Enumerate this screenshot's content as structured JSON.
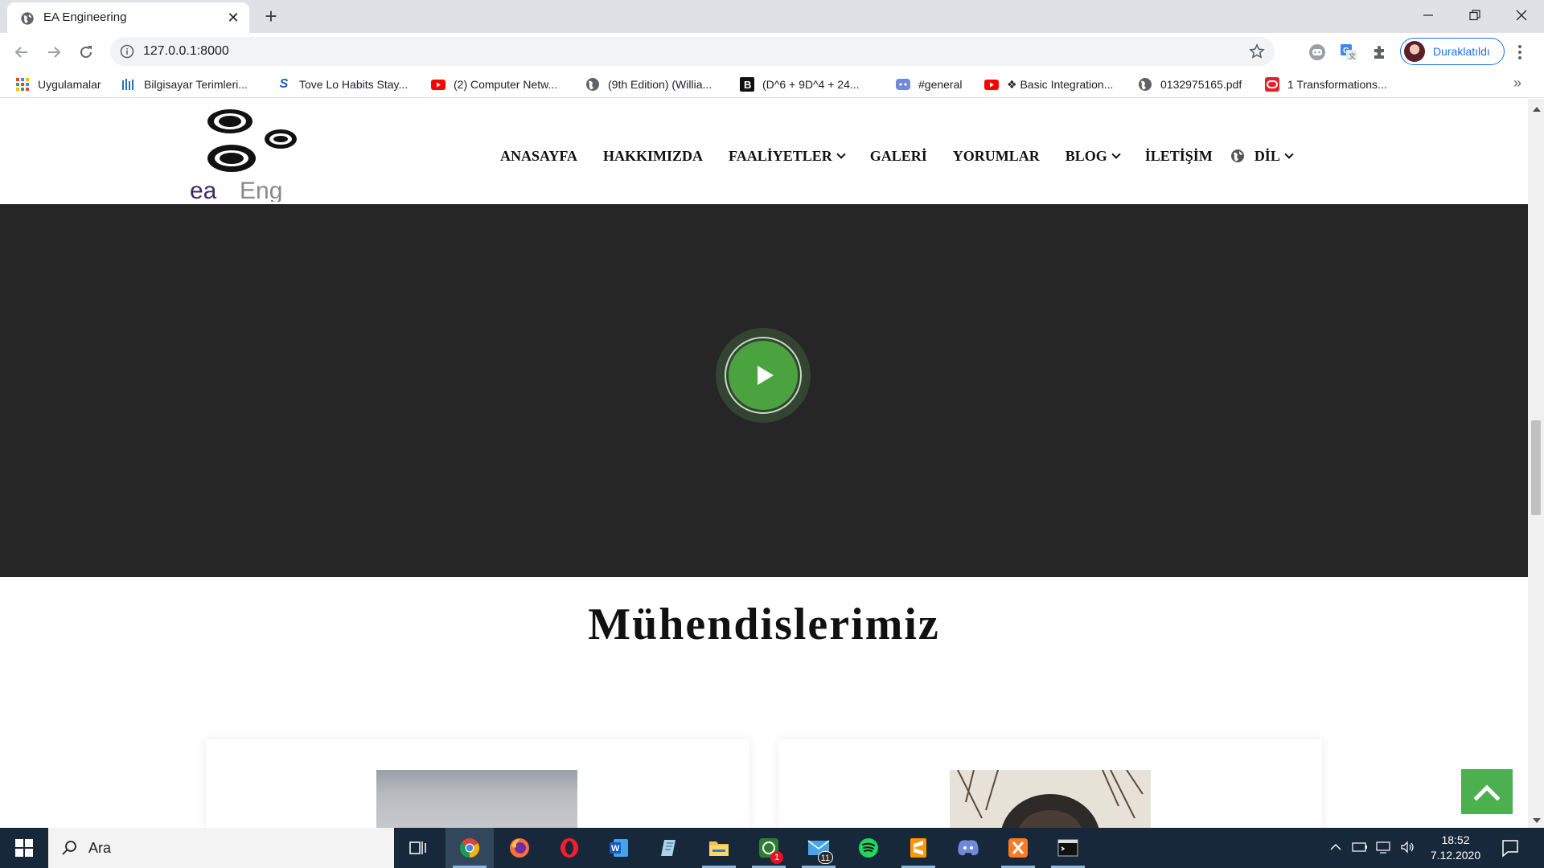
{
  "browser": {
    "tab": {
      "title": "EA Engineering",
      "close": "✕"
    },
    "new_tab": "+",
    "address": "127.0.0.1:8000",
    "profile_label": "Duraklatıldı"
  },
  "bookmarks": [
    {
      "label": "Uygulamalar",
      "icon": "apps-grid-icon"
    },
    {
      "label": "Bilgisayar Terimleri...",
      "icon": "dictionary-icon"
    },
    {
      "label": "Tove Lo Habits Stay...",
      "icon": "s-logo-icon"
    },
    {
      "label": "(2) Computer Netw...",
      "icon": "youtube-icon"
    },
    {
      "label": "(9th Edition) (Willia...",
      "icon": "globe-icon"
    },
    {
      "label": "(D^6 + 9D^4 + 24...",
      "icon": "b-logo-icon"
    },
    {
      "label": "#general",
      "icon": "discord-icon"
    },
    {
      "label": "❖ Basic Integration...",
      "icon": "youtube-icon"
    },
    {
      "label": "0132975165.pdf",
      "icon": "globe-icon"
    },
    {
      "label": "1 Transformations...",
      "icon": "red-logo-icon"
    }
  ],
  "bookmarks_more": "»",
  "site": {
    "logo_text": {
      "left": "ea",
      "right": "Eng"
    },
    "nav": [
      {
        "label": "ANASAYFA",
        "dropdown": false
      },
      {
        "label": "HAKKIMIZDA",
        "dropdown": false
      },
      {
        "label": "FAALİYETLER",
        "dropdown": true
      },
      {
        "label": "GALERİ",
        "dropdown": false
      },
      {
        "label": "YORUMLAR",
        "dropdown": false
      },
      {
        "label": "BLOG",
        "dropdown": true
      },
      {
        "label": "İLETİŞİM",
        "dropdown": false
      },
      {
        "label": "DİL",
        "dropdown": true,
        "icon": "globe-icon"
      }
    ],
    "section_title": "Mühendislerimiz",
    "accent_color": "#4caf50",
    "video_bg": "#262626"
  },
  "taskbar": {
    "search_placeholder": "Ara",
    "apps": [
      {
        "name": "task-view",
        "active": false
      },
      {
        "name": "chrome",
        "active": true
      },
      {
        "name": "firefox",
        "active": false
      },
      {
        "name": "opera",
        "active": false
      },
      {
        "name": "word",
        "active": false
      },
      {
        "name": "notes",
        "active": false
      },
      {
        "name": "file-explorer",
        "active": false
      },
      {
        "name": "whatsapp",
        "active": false,
        "badge": "1"
      },
      {
        "name": "mail",
        "active": false,
        "badge": "11"
      },
      {
        "name": "spotify",
        "active": false
      },
      {
        "name": "sublime-text",
        "active": false
      },
      {
        "name": "discord",
        "active": false
      },
      {
        "name": "xampp",
        "active": false
      },
      {
        "name": "terminal",
        "active": false
      }
    ],
    "time": "18:52",
    "date": "7.12.2020"
  }
}
